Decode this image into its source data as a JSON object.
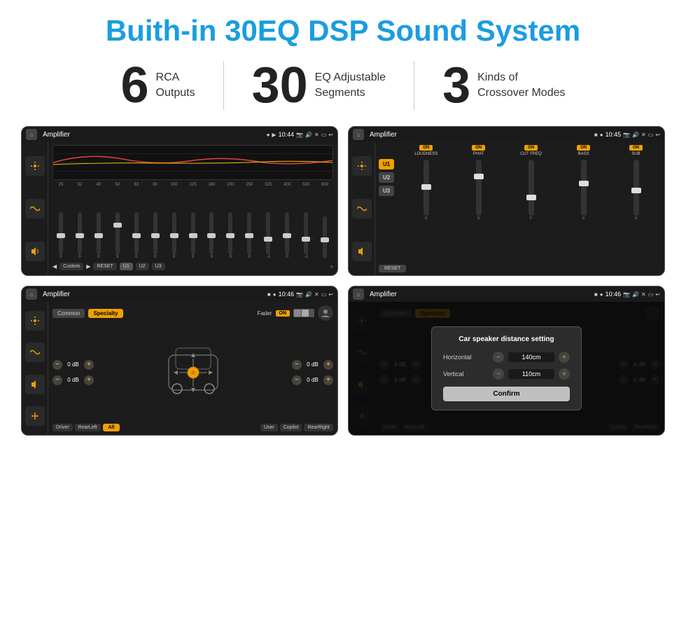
{
  "title": "Buith-in 30EQ DSP Sound System",
  "stats": [
    {
      "number": "6",
      "label_line1": "RCA",
      "label_line2": "Outputs"
    },
    {
      "number": "30",
      "label_line1": "EQ Adjustable",
      "label_line2": "Segments"
    },
    {
      "number": "3",
      "label_line1": "Kinds of",
      "label_line2": "Crossover Modes"
    }
  ],
  "screens": [
    {
      "id": "eq-screen",
      "status_bar": {
        "title": "Amplifier",
        "time": "10:44"
      },
      "type": "eq"
    },
    {
      "id": "crossover-screen",
      "status_bar": {
        "title": "Amplifier",
        "time": "10:45"
      },
      "type": "crossover"
    },
    {
      "id": "fader-screen",
      "status_bar": {
        "title": "Amplifier",
        "time": "10:46"
      },
      "type": "fader"
    },
    {
      "id": "dialog-screen",
      "status_bar": {
        "title": "Amplifier",
        "time": "10:46"
      },
      "type": "dialog"
    }
  ],
  "eq": {
    "frequencies": [
      "25",
      "32",
      "40",
      "50",
      "63",
      "80",
      "100",
      "125",
      "160",
      "200",
      "250",
      "320",
      "400",
      "500",
      "630"
    ],
    "values": [
      "0",
      "0",
      "0",
      "5",
      "0",
      "0",
      "0",
      "0",
      "0",
      "0",
      "0",
      "-1",
      "0",
      "-1",
      ""
    ],
    "presets": [
      "Custom",
      "RESET",
      "U1",
      "U2",
      "U3"
    ]
  },
  "crossover": {
    "presets": [
      "U1",
      "U2",
      "U3"
    ],
    "channels": [
      {
        "name": "LOUDNESS",
        "on": true
      },
      {
        "name": "PHAT",
        "on": true
      },
      {
        "name": "CUT FREQ",
        "on": true
      },
      {
        "name": "BASS",
        "on": true
      },
      {
        "name": "SUB",
        "on": true
      }
    ],
    "reset": "RESET"
  },
  "fader": {
    "tabs": [
      "Common",
      "Specialty"
    ],
    "fader_label": "Fader",
    "toggle_on": "ON",
    "db_values": [
      "0 dB",
      "0 dB",
      "0 dB",
      "0 dB"
    ],
    "positions": [
      "Driver",
      "RearLeft",
      "All",
      "Copilot",
      "RearRight",
      "User"
    ]
  },
  "dialog": {
    "title": "Car speaker distance setting",
    "horizontal_label": "Horizontal",
    "horizontal_value": "140cm",
    "vertical_label": "Vertical",
    "vertical_value": "110cm",
    "confirm_label": "Confirm",
    "db_values": [
      "0 dB",
      "0 dB"
    ],
    "positions": [
      "Driver",
      "RearLeft",
      "Copilot",
      "RearRight",
      "User"
    ]
  }
}
